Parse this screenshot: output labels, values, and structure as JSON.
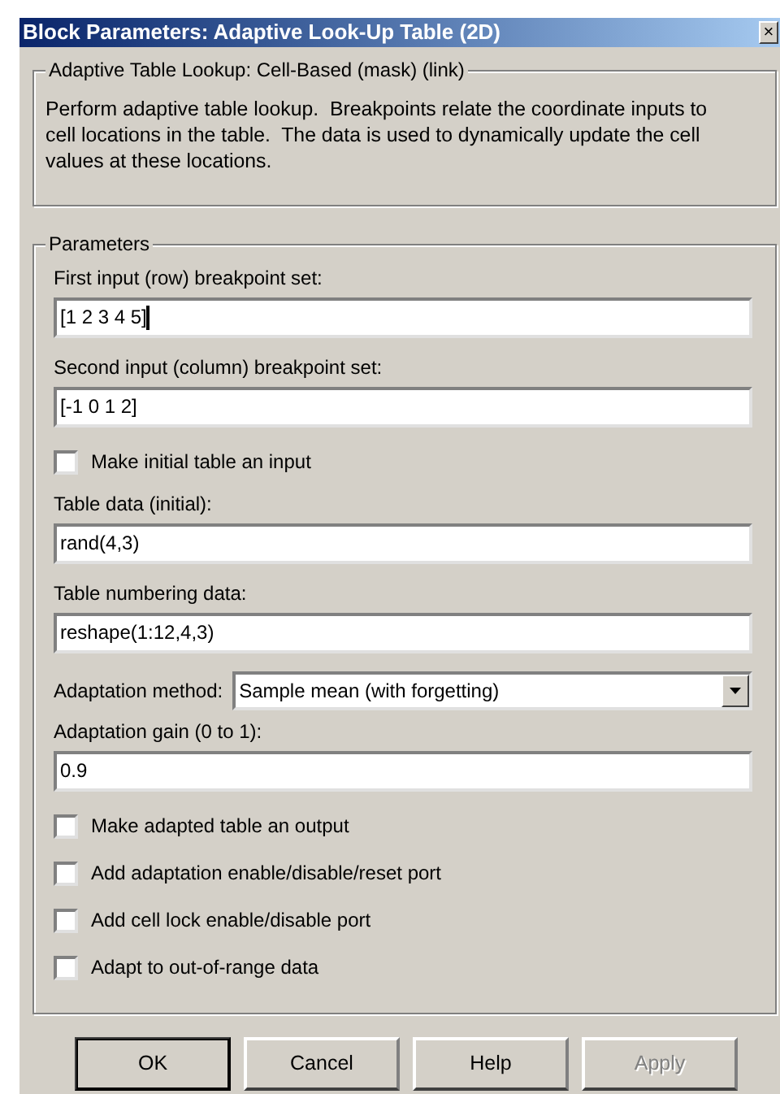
{
  "window": {
    "title": "Block Parameters: Adaptive Look-Up Table (2D)",
    "close": "×"
  },
  "description": {
    "legend": "Adaptive Table Lookup: Cell-Based (mask) (link)",
    "text": "Perform adaptive table lookup.  Breakpoints relate the coordinate inputs to cell locations in the table.  The data is used to dynamically update the cell values at these locations."
  },
  "parameters": {
    "legend": "Parameters",
    "items": [
      {
        "kind": "field",
        "label": "First input (row) breakpoint set:",
        "value": "[1 2 3 4 5]",
        "focused": true
      },
      {
        "kind": "field",
        "label": "Second input (column) breakpoint set:",
        "value": "[-1 0 1 2]",
        "focused": false
      },
      {
        "kind": "checkbox",
        "label": "Make initial table an input",
        "checked": false
      },
      {
        "kind": "field",
        "label": "Table data (initial):",
        "value": "rand(4,3)",
        "focused": false
      },
      {
        "kind": "field",
        "label": "Table numbering data:",
        "value": "reshape(1:12,4,3)",
        "focused": false
      },
      {
        "kind": "dropdown",
        "label": "Adaptation method:",
        "value": "Sample mean (with forgetting)"
      },
      {
        "kind": "field",
        "label": "Adaptation gain (0 to 1):",
        "value": "0.9",
        "focused": false
      },
      {
        "kind": "checkbox",
        "label": "Make adapted table an output",
        "checked": false
      },
      {
        "kind": "checkbox",
        "label": "Add adaptation enable/disable/reset port",
        "checked": false
      },
      {
        "kind": "checkbox",
        "label": "Add cell lock enable/disable port",
        "checked": false
      },
      {
        "kind": "checkbox",
        "label": "Adapt to out-of-range data",
        "checked": false
      }
    ]
  },
  "buttons": [
    {
      "label": "OK",
      "default": true,
      "disabled": false
    },
    {
      "label": "Cancel",
      "default": false,
      "disabled": false
    },
    {
      "label": "Help",
      "default": false,
      "disabled": false
    },
    {
      "label": "Apply",
      "default": false,
      "disabled": true
    }
  ]
}
